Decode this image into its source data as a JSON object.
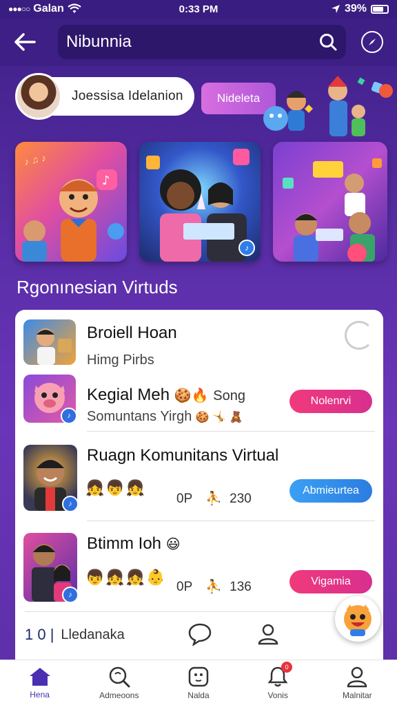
{
  "status_bar": {
    "carrier": "Galan",
    "time": "0:33 PM",
    "battery": "39%"
  },
  "header": {
    "title": "Nibunnia"
  },
  "hero": {
    "profile_name": "Joessisa Idelanion",
    "tag_chip": "Nideleta"
  },
  "section": {
    "title": "Rgonınesian Virtuds"
  },
  "list": {
    "items": [
      {
        "title": "Broiell Hoan",
        "subtitle": "Himg Pirbs"
      },
      {
        "title": "Kegial Meh",
        "title_suffix": "Song",
        "subtitle": "Somuntans Yirgh",
        "action": "Nolenrvi"
      },
      {
        "title": "Ruagn Komunitans Virtual",
        "meta_label": "0P",
        "meta_count": "230",
        "action": "Abmieurtea"
      },
      {
        "title": "Btimm Ioh",
        "meta_label": "0P",
        "meta_count": "136",
        "action": "Vigamia"
      }
    ],
    "footer": {
      "count": "1 0 |",
      "label": "Lledanaka"
    }
  },
  "bottom_nav": {
    "items": [
      {
        "label": "Hena",
        "icon": "home-icon"
      },
      {
        "label": "Admeoons",
        "icon": "search-icon"
      },
      {
        "label": "Nalda",
        "icon": "game-icon"
      },
      {
        "label": "Vonis",
        "icon": "bell-icon",
        "badge": "0"
      },
      {
        "label": "Malnitar",
        "icon": "profile-icon"
      }
    ]
  },
  "colors": {
    "primary": "#3d1f86",
    "accent_pink": "#f03a7b",
    "accent_blue": "#3aa0f4",
    "chip_purple": "#c463dc"
  }
}
